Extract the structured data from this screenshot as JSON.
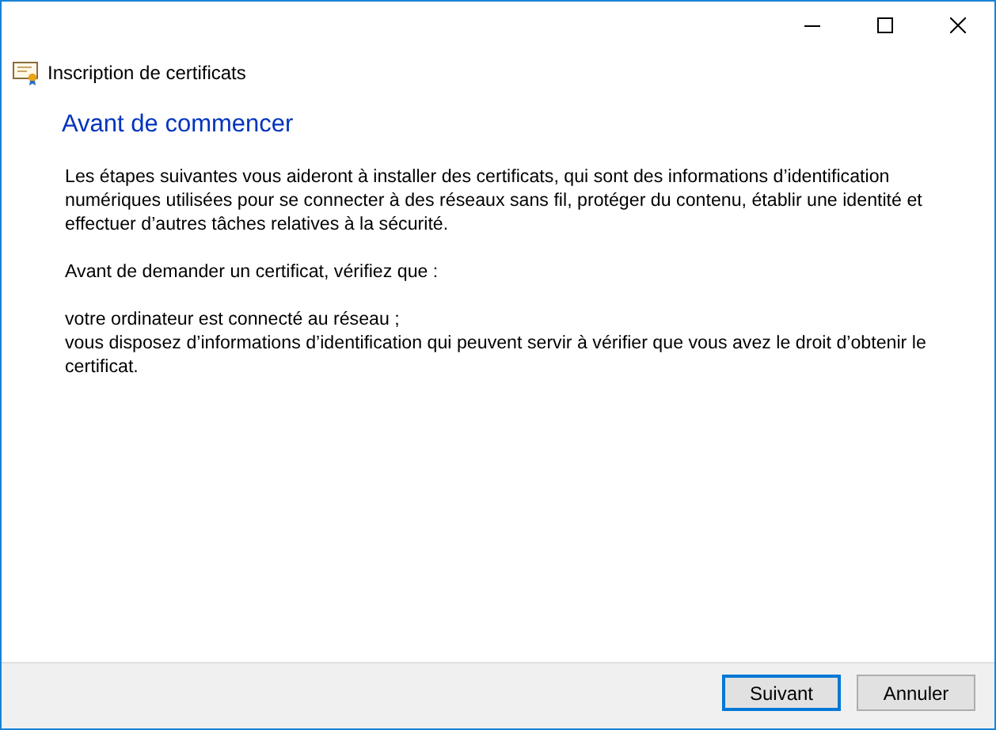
{
  "window": {
    "title": "Inscription de certificats"
  },
  "heading": "Avant de commencer",
  "paragraphs": [
    "Les étapes suivantes vous aideront à installer des certificats, qui sont des informations d’identification numériques utilisées pour se connecter à des réseaux sans fil, protéger du contenu, établir une identité et effectuer d’autres tâches relatives à la sécurité.",
    "Avant de demander un certificat, vérifiez que :",
    "votre ordinateur est connecté au réseau ;\nvous disposez d’informations d’identification qui peuvent servir à vérifier que vous avez le droit d’obtenir le certificat."
  ],
  "buttons": [
    {
      "label": "Suivant",
      "default": true
    },
    {
      "label": "Annuler",
      "default": false
    }
  ]
}
